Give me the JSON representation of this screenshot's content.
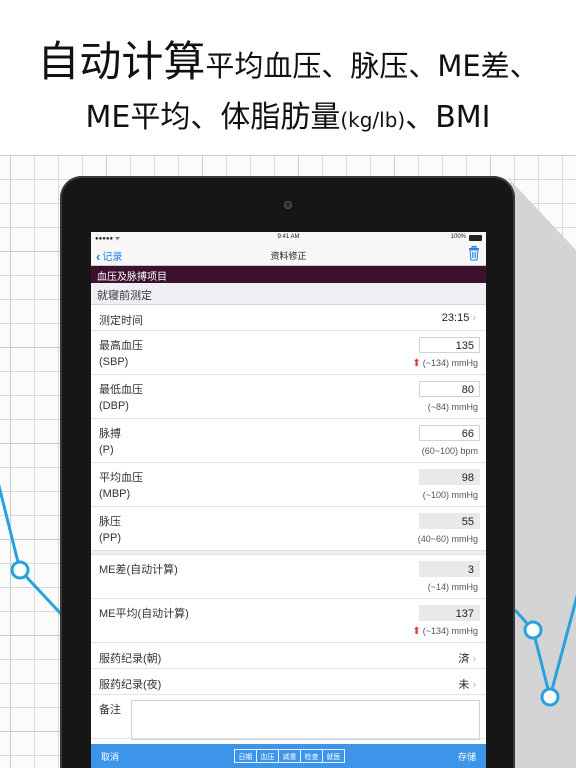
{
  "headline": {
    "line1_big": "自动计算",
    "line1_rest": "平均血压、脉压、ME差、",
    "line2_main": "ME平均、体脂肪量",
    "line2_unit": "(kg/lb)",
    "line2_tail": "、BMI"
  },
  "status_bar": {
    "carrier": "●●●●● ᯤ",
    "time": "9:41 AM",
    "battery": "100%"
  },
  "nav": {
    "back_label": "记录",
    "title": "资料修正"
  },
  "section_header": "血压及脉搏项目",
  "sub_header": "就寝前测定",
  "rows": {
    "time": {
      "label": "测定时间",
      "value": "23:15"
    },
    "sbp": {
      "label": "最高血压",
      "sub": "(SBP)",
      "value": "135",
      "note": "(~134) mmHg"
    },
    "dbp": {
      "label": "最低血压",
      "sub": "(DBP)",
      "value": "80",
      "note": "(~84) mmHg"
    },
    "pulse": {
      "label": "脉搏",
      "sub": "(P)",
      "value": "66",
      "note": "(60~100) bpm"
    },
    "mbp": {
      "label": "平均血压",
      "sub": "(MBP)",
      "value": "98",
      "note": "(~100) mmHg"
    },
    "pp": {
      "label": "脉压",
      "sub": "(PP)",
      "value": "55",
      "note": "(40~60) mmHg"
    },
    "me_diff": {
      "label": "ME差(自动计算)",
      "value": "3",
      "note": "(~14) mmHg"
    },
    "me_avg": {
      "label": "ME平均(自动计算)",
      "value": "137",
      "note": "(~134) mmHg"
    },
    "med_morning": {
      "label": "服药纪录(朝)",
      "value": "済"
    },
    "med_night": {
      "label": "服药纪录(夜)",
      "value": "未"
    },
    "memo": {
      "label": "备注"
    }
  },
  "bottom_bar": {
    "cancel": "取消",
    "save": "存储",
    "tabs": [
      "日期",
      "血压",
      "减重",
      "检查",
      "就医"
    ]
  },
  "colors": {
    "section_header_bg": "#3c1130",
    "bottom_bar_bg": "#3d95ea",
    "accent_blue": "#1e7ee8",
    "alert_red": "#e0393a",
    "bg_line": "#27a3dc"
  },
  "icons": {
    "back": "chevron-left-icon",
    "trash": "trash-icon",
    "row_chevron": "chevron-right-icon",
    "alert": "red-up-arrow-icon"
  }
}
